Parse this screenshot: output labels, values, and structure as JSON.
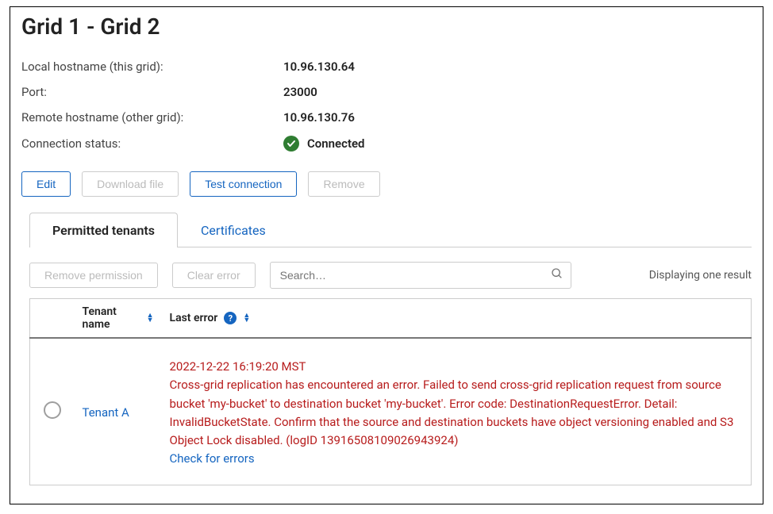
{
  "page_title": "Grid 1 - Grid 2",
  "details": {
    "local_hostname_label": "Local hostname (this grid):",
    "local_hostname_value": "10.96.130.64",
    "port_label": "Port:",
    "port_value": "23000",
    "remote_hostname_label": "Remote hostname (other grid):",
    "remote_hostname_value": "10.96.130.76",
    "connection_status_label": "Connection status:",
    "connection_status_value": "Connected"
  },
  "buttons": {
    "edit": "Edit",
    "download_file": "Download file",
    "test_connection": "Test connection",
    "remove": "Remove"
  },
  "tabs": {
    "permitted_tenants": "Permitted tenants",
    "certificates": "Certificates"
  },
  "toolbar": {
    "remove_permission": "Remove permission",
    "clear_error": "Clear error",
    "search_placeholder": "Search…",
    "result_text": "Displaying one result"
  },
  "table": {
    "headers": {
      "tenant_name": "Tenant name",
      "last_error": "Last error"
    },
    "rows": [
      {
        "tenant_name": "Tenant A",
        "error_timestamp": "2022-12-22 16:19:20 MST",
        "error_message": "Cross-grid replication has encountered an error. Failed to send cross-grid replication request from source bucket 'my-bucket' to destination bucket 'my-bucket'. Error code: DestinationRequestError. Detail: InvalidBucketState. Confirm that the source and destination buckets have object versioning enabled and S3 Object Lock disabled. (logID 13916508109026943924)",
        "check_link": "Check for errors"
      }
    ]
  }
}
